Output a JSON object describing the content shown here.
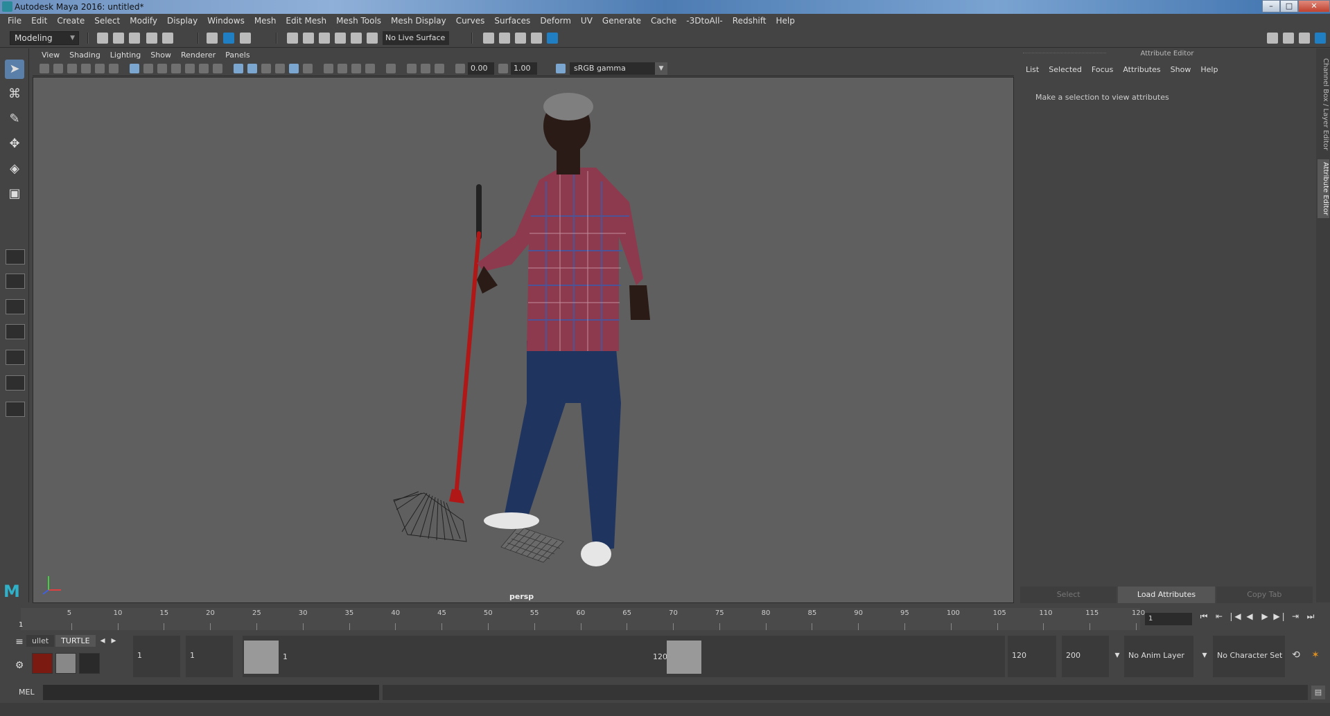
{
  "window": {
    "title": "Autodesk Maya 2016: untitled*",
    "minimize": "–",
    "maximize": "□",
    "close": "✕"
  },
  "menubar": [
    "File",
    "Edit",
    "Create",
    "Select",
    "Modify",
    "Display",
    "Windows",
    "Mesh",
    "Edit Mesh",
    "Mesh Tools",
    "Mesh Display",
    "Curves",
    "Surfaces",
    "Deform",
    "UV",
    "Generate",
    "Cache",
    "-3DtoAll-",
    "Redshift",
    "Help"
  ],
  "shelf": {
    "mode": "Modeling",
    "live_surface": "No Live Surface"
  },
  "viewport": {
    "menus": [
      "View",
      "Shading",
      "Lighting",
      "Show",
      "Renderer",
      "Panels"
    ],
    "exposure": "0.00",
    "gamma_value": "1.00",
    "color_space": "sRGB gamma",
    "camera_label": "persp",
    "colors": {
      "shirt": "#8e3a4e",
      "jeans": "#1f3560",
      "skin": "#2a1b16",
      "rake": "#b01818",
      "shoes": "#e6e6e6"
    }
  },
  "attribute_editor": {
    "title": "Attribute Editor",
    "menus": [
      "List",
      "Selected",
      "Focus",
      "Attributes",
      "Show",
      "Help"
    ],
    "message": "Make a selection to view attributes",
    "buttons": [
      "Select",
      "Load Attributes",
      "Copy Tab"
    ]
  },
  "side_tabs": [
    "Channel Box / Layer Editor",
    "Attribute Editor"
  ],
  "timeline": {
    "ticks": [
      "5",
      "10",
      "15",
      "20",
      "25",
      "30",
      "35",
      "40",
      "45",
      "50",
      "55",
      "60",
      "65",
      "70",
      "75",
      "80",
      "85",
      "90",
      "95",
      "100",
      "105",
      "110",
      "115",
      "120"
    ],
    "current_frame": "1",
    "frame_field": "1"
  },
  "range": {
    "shelf_tabs": [
      "ullet",
      "TURTLE"
    ],
    "start": "1",
    "playback_start": "1",
    "slider_start": "1",
    "slider_end": "120",
    "playback_end": "120",
    "end": "200",
    "anim_layer": "No Anim Layer",
    "character_set": "No Character Set"
  },
  "cmdline": {
    "label": "MEL"
  }
}
